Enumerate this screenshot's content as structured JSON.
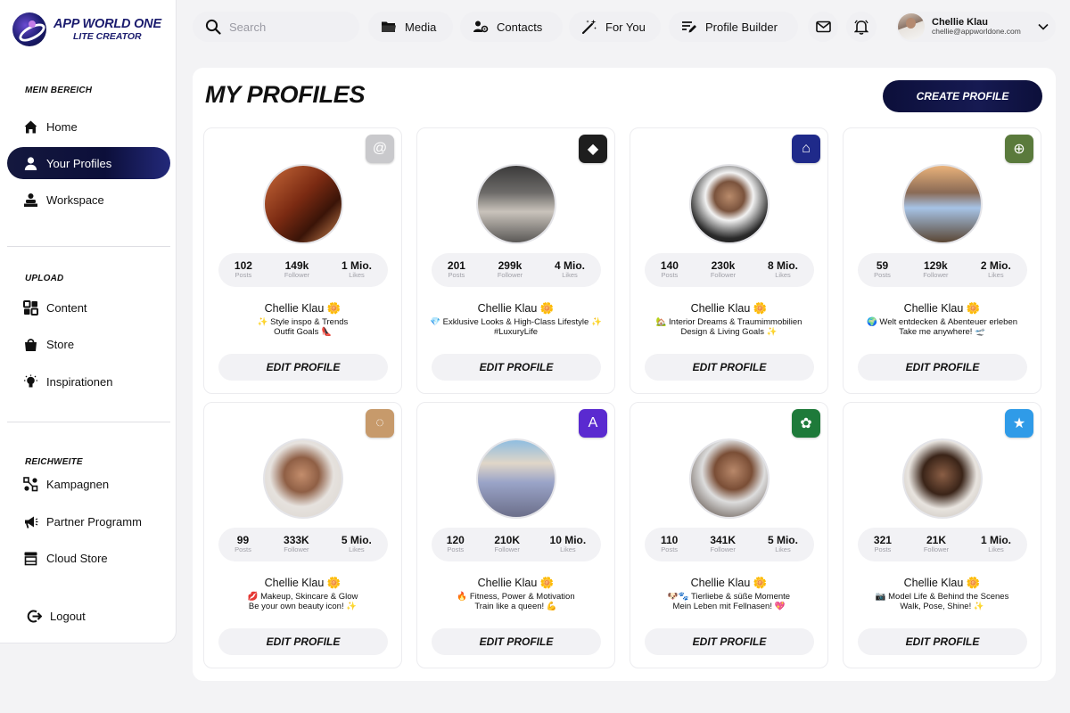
{
  "app": {
    "title": "APP WORLD ONE",
    "subtitle": "LITE CREATOR"
  },
  "sidebar": {
    "sections": [
      {
        "title": "MEIN BEREICH"
      },
      {
        "title": "UPLOAD"
      },
      {
        "title": "REICHWEITE"
      }
    ],
    "items": [
      {
        "label": "Home",
        "icon": "home-icon"
      },
      {
        "label": "Your Profiles",
        "icon": "user-icon",
        "active": true
      },
      {
        "label": "Workspace",
        "icon": "workspace-icon"
      },
      {
        "label": "Content",
        "icon": "grid-icon"
      },
      {
        "label": "Store",
        "icon": "bag-icon"
      },
      {
        "label": "Inspirationen",
        "icon": "lightbulb-icon"
      },
      {
        "label": "Kampagnen",
        "icon": "network-icon"
      },
      {
        "label": "Partner Programm",
        "icon": "megaphone-icon"
      },
      {
        "label": "Cloud Store",
        "icon": "storefront-icon"
      }
    ],
    "logout": "Logout"
  },
  "topbar": {
    "search_placeholder": "Search",
    "nav": [
      {
        "label": "Media",
        "icon": "folder-icon"
      },
      {
        "label": "Contacts",
        "icon": "contacts-icon"
      },
      {
        "label": "For You",
        "icon": "magic-wand-icon"
      },
      {
        "label": "Profile Builder",
        "icon": "edit-list-icon"
      }
    ],
    "user": {
      "name": "Chellie Klau",
      "email": "chellie@appworldone.com"
    }
  },
  "main": {
    "title": "MY PROFILES",
    "create_button": "CREATE PROFILE",
    "stat_labels": {
      "posts": "Posts",
      "follower": "Follower",
      "likes": "Likes"
    },
    "edit_label": "EDIT PROFILE",
    "profiles": [
      {
        "name": "Chellie Klau 🌼",
        "posts": "102",
        "follower": "149k",
        "likes": "1 Mio.",
        "bio1": "✨ Style inspo & Trends",
        "bio2": "Outfit Goals 👠",
        "badge_color": "#c9c9cc",
        "badge_icon": "threads-icon"
      },
      {
        "name": "Chellie Klau 🌼",
        "posts": "201",
        "follower": "299k",
        "likes": "4 Mio.",
        "bio1": "💎 Exklusive Looks & High-Class Lifestyle ✨",
        "bio2": "#LuxuryLife",
        "badge_color": "#1e1e1e",
        "badge_icon": "diamond-icon"
      },
      {
        "name": "Chellie Klau 🌼",
        "posts": "140",
        "follower": "230k",
        "likes": "8 Mio.",
        "bio1": "🏡 Interior Dreams & Traumimmobilien",
        "bio2": "Design & Living Goals ✨",
        "badge_color": "#1f2a8a",
        "badge_icon": "house-icon"
      },
      {
        "name": "Chellie Klau 🌼",
        "posts": "59",
        "follower": "129k",
        "likes": "2 Mio.",
        "bio1": "🌍 Welt entdecken & Abenteuer erleben",
        "bio2": "Take me anywhere! 🛫",
        "badge_color": "#5a7a3c",
        "badge_icon": "target-icon"
      },
      {
        "name": "Chellie Klau 🌼",
        "posts": "99",
        "follower": "333K",
        "likes": "5 Mio.",
        "bio1": "💋 Makeup, Skincare & Glow",
        "bio2": "Be your own beauty icon! ✨",
        "badge_color": "#c79a6b",
        "badge_icon": "circle-dashed-icon"
      },
      {
        "name": "Chellie Klau 🌼",
        "posts": "120",
        "follower": "210K",
        "likes": "10 Mio.",
        "bio1": "🔥 Fitness, Power & Motivation",
        "bio2": "Train like a queen! 💪",
        "badge_color": "#5a2ad0",
        "badge_icon": "letter-a-icon"
      },
      {
        "name": "Chellie Klau 🌼",
        "posts": "110",
        "follower": "341K",
        "likes": "5 Mio.",
        "bio1": "🐶🐾 Tierliebe & süße Momente",
        "bio2": "Mein Leben mit Fellnasen! 💖",
        "badge_color": "#1e7a3a",
        "badge_icon": "paw-icon"
      },
      {
        "name": "Chellie Klau 🌼",
        "posts": "321",
        "follower": "21K",
        "likes": "1 Mio.",
        "bio1": "📷 Model Life & Behind the Scenes",
        "bio2": "Walk, Pose, Shine! ✨",
        "badge_color": "#2f9be8",
        "badge_icon": "star-icon"
      }
    ]
  }
}
